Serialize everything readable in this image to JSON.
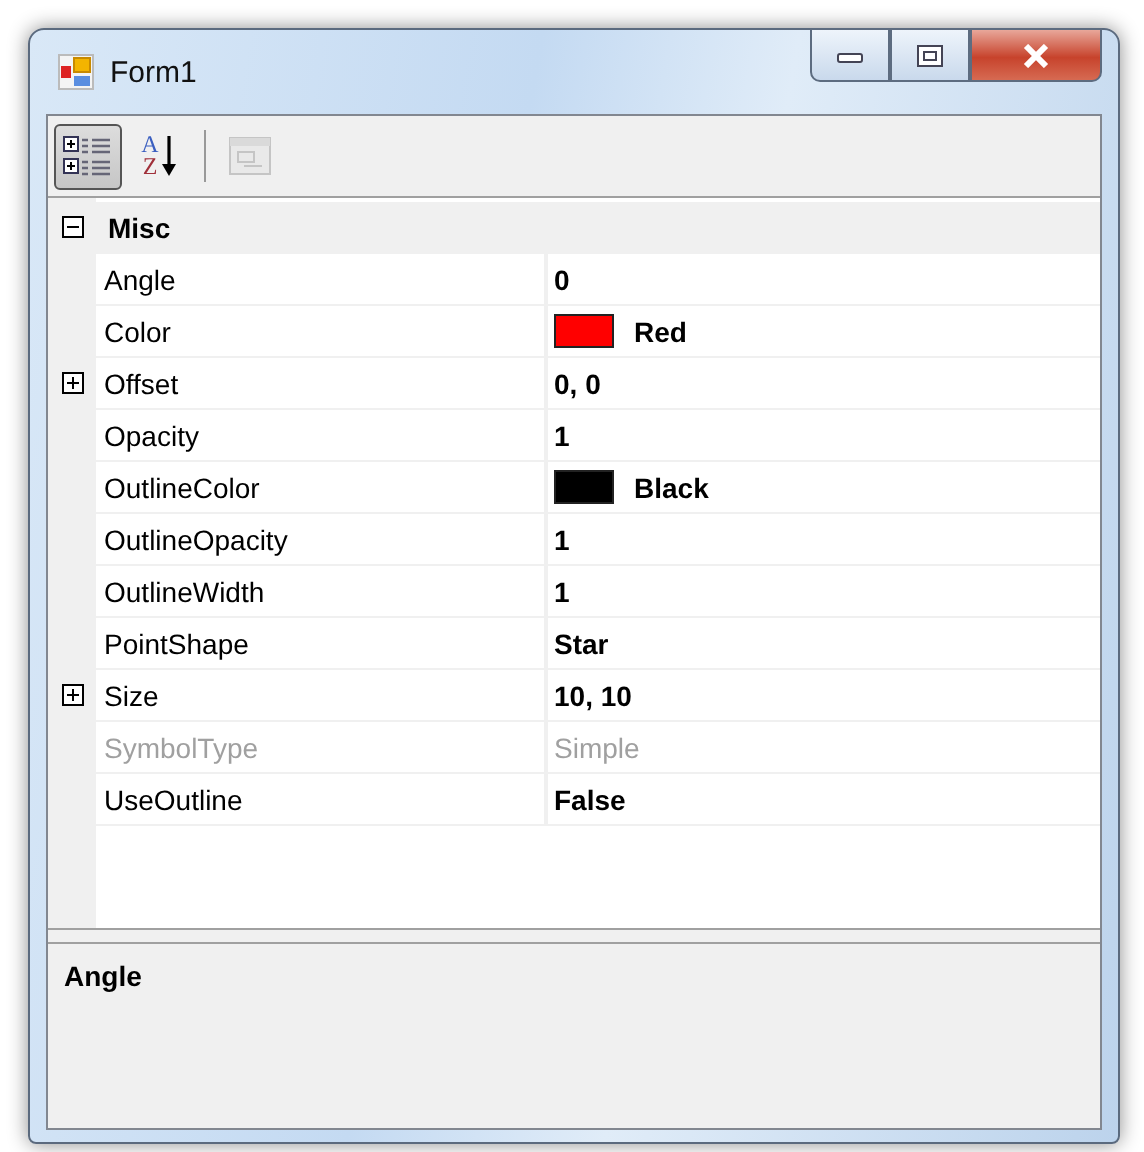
{
  "window": {
    "title": "Form1"
  },
  "toolbar": [
    {
      "kind": "categorized",
      "selected": true,
      "disabled": false
    },
    {
      "kind": "alphabetical",
      "selected": false,
      "disabled": false,
      "letter_top": "A",
      "letter_bottom": "Z"
    },
    {
      "kind": "property_pages",
      "selected": false,
      "disabled": true
    }
  ],
  "category": {
    "name": "Misc",
    "expanded": true
  },
  "properties": [
    {
      "kind": "text",
      "name": "Angle",
      "value": "0",
      "modified": true,
      "disabled": false
    },
    {
      "kind": "color",
      "name": "Color",
      "value": "Red",
      "color": "#ff0000",
      "modified": true,
      "disabled": false
    },
    {
      "kind": "composite",
      "name": "Offset",
      "value": "0, 0",
      "expanded": false,
      "modified": true,
      "disabled": false
    },
    {
      "kind": "text",
      "name": "Opacity",
      "value": "1",
      "modified": true,
      "disabled": false
    },
    {
      "kind": "color",
      "name": "OutlineColor",
      "value": "Black",
      "color": "#000000",
      "modified": true,
      "disabled": false
    },
    {
      "kind": "text",
      "name": "OutlineOpacity",
      "value": "1",
      "modified": true,
      "disabled": false
    },
    {
      "kind": "text",
      "name": "OutlineWidth",
      "value": "1",
      "modified": true,
      "disabled": false
    },
    {
      "kind": "text",
      "name": "PointShape",
      "value": "Star",
      "modified": true,
      "disabled": false
    },
    {
      "kind": "composite",
      "name": "Size",
      "value": "10, 10",
      "expanded": false,
      "modified": true,
      "disabled": false
    },
    {
      "kind": "text",
      "name": "SymbolType",
      "value": "Simple",
      "modified": false,
      "disabled": true
    },
    {
      "kind": "text",
      "name": "UseOutline",
      "value": "False",
      "modified": true,
      "disabled": false
    }
  ],
  "description": {
    "title": "Angle"
  }
}
